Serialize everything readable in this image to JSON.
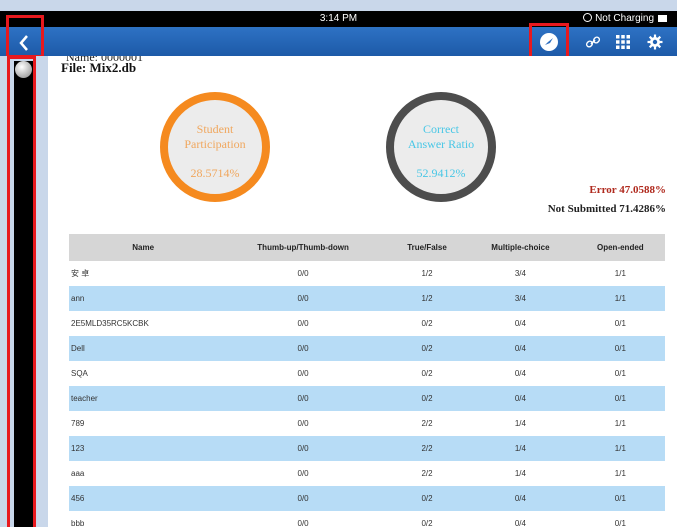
{
  "status_bar": {
    "time": "3:14 PM",
    "charging": "Not Charging"
  },
  "nav": {
    "back_icon": "chevron-left-icon",
    "icons": [
      "checkmark-circle-icon",
      "link-icon",
      "grid-icon",
      "gear-icon"
    ]
  },
  "header": {
    "name_line": "Name: 0000001",
    "file_line": "File: Mix2.db"
  },
  "stats": {
    "participation_label_1": "Student",
    "participation_label_2": "Participation",
    "participation_value": "28.5714%",
    "correct_label_1": "Correct",
    "correct_label_2": "Answer Ratio",
    "correct_value": "52.9412%",
    "error": "Error 47.0588%",
    "not_submitted": "Not Submitted 71.4286%"
  },
  "table": {
    "headers": [
      "Name",
      "Thumb-up/Thumb-down",
      "True/False",
      "Multiple-choice",
      "Open-ended"
    ],
    "rows": [
      [
        "安 卓",
        "0/0",
        "1/2",
        "3/4",
        "1/1"
      ],
      [
        "ann",
        "0/0",
        "1/2",
        "3/4",
        "1/1"
      ],
      [
        "2E5MLD35RC5KCBK",
        "0/0",
        "0/2",
        "0/4",
        "0/1"
      ],
      [
        "Dell",
        "0/0",
        "0/2",
        "0/4",
        "0/1"
      ],
      [
        "SQA",
        "0/0",
        "0/2",
        "0/4",
        "0/1"
      ],
      [
        "teacher",
        "0/0",
        "0/2",
        "0/4",
        "0/1"
      ],
      [
        "789",
        "0/0",
        "2/2",
        "1/4",
        "1/1"
      ],
      [
        "123",
        "0/0",
        "2/2",
        "1/4",
        "1/1"
      ],
      [
        "aaa",
        "0/0",
        "2/2",
        "1/4",
        "1/1"
      ],
      [
        "456",
        "0/0",
        "0/2",
        "0/4",
        "0/1"
      ],
      [
        "bbb",
        "0/0",
        "0/2",
        "0/4",
        "0/1"
      ]
    ]
  },
  "colors": {
    "participation": "#f58a1f",
    "correct": "#4d4d4d",
    "error": "#b02a1e",
    "highlight": "#e8191e",
    "nav": "#1d5aa8",
    "row_alt": "#b7dcf6"
  }
}
